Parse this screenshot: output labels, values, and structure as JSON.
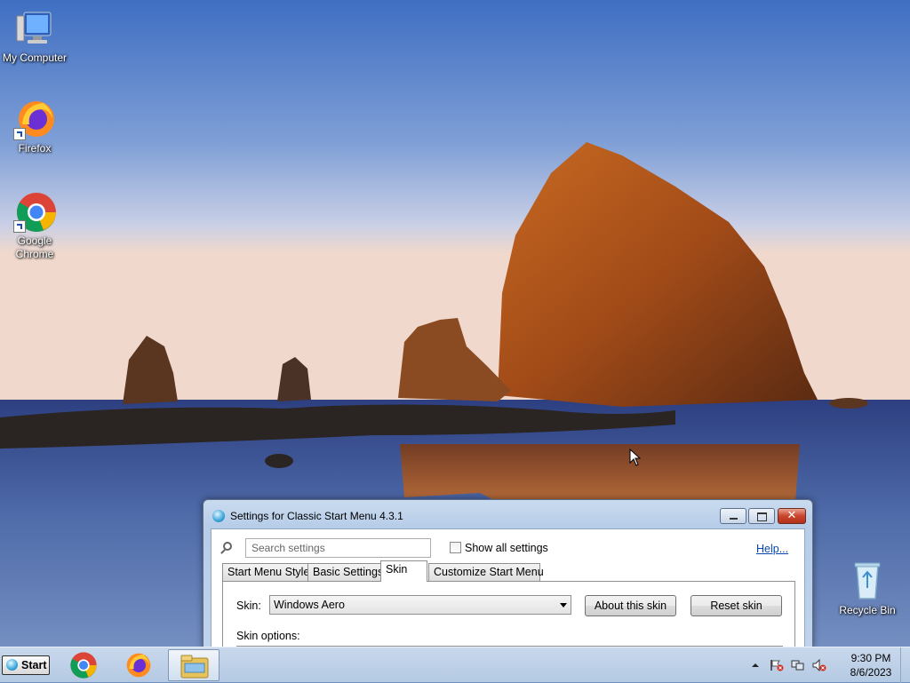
{
  "desktop": {
    "icons": [
      {
        "label": "My Computer",
        "icon": "computer-icon"
      },
      {
        "label": "Firefox",
        "icon": "firefox-icon"
      },
      {
        "label": "Google Chrome",
        "icon": "chrome-icon"
      },
      {
        "label": "Recycle Bin",
        "icon": "recycle-bin-icon"
      }
    ]
  },
  "dialog": {
    "title": "Settings for Classic Start Menu 4.3.1",
    "search_placeholder": "Search settings",
    "show_all_label": "Show all settings",
    "help_label": "Help...",
    "tabs": [
      {
        "label": "Start Menu Style",
        "active": false
      },
      {
        "label": "Basic Settings",
        "active": false
      },
      {
        "label": "Skin",
        "active": true
      },
      {
        "label": "Customize Start Menu",
        "active": false
      }
    ],
    "skin_label": "Skin:",
    "skin_value": "Windows Aero",
    "about_skin_label": "About this skin",
    "reset_skin_label": "Reset skin",
    "skin_options_label": "Skin options:"
  },
  "taskbar": {
    "start_label": "Start",
    "apps": [
      "chrome-icon",
      "firefox-icon",
      "file-explorer-icon"
    ],
    "tray_icons": [
      "show-hidden-icons-chevron",
      "action-center-flag-icon",
      "network-icon",
      "volume-muted-icon"
    ],
    "time": "9:30 PM",
    "date": "8/6/2023"
  },
  "colors": {
    "taskbar": "#c4d6ec",
    "title_bar": "#bfd3ec",
    "close_button": "#c9452b",
    "link": "#0645ad"
  }
}
